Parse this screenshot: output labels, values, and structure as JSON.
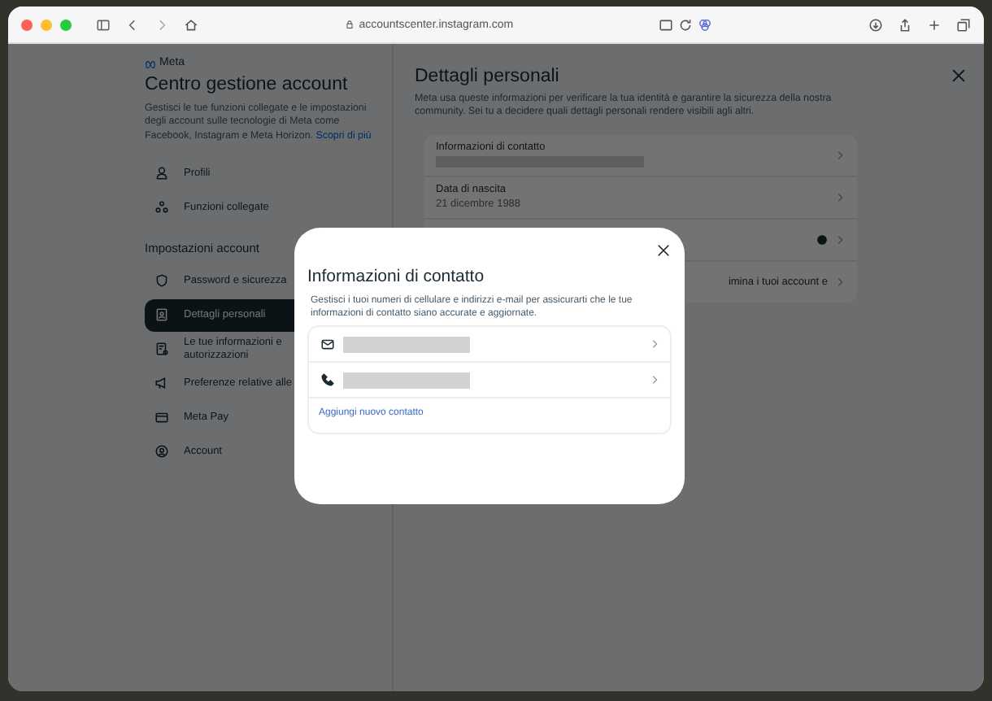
{
  "browser": {
    "url": "accountscenter.instagram.com"
  },
  "sidebar": {
    "brand": "Meta",
    "title": "Centro gestione account",
    "description": "Gestisci le tue funzioni collegate e le impostazioni degli account sulle tecnologie di Meta come Facebook, Instagram e Meta Horizon.",
    "link": "Scopri di più",
    "items": [
      {
        "label": "Profili",
        "selected": false
      },
      {
        "label": "Funzioni collegate",
        "selected": false
      }
    ],
    "section": "Impostazioni account",
    "settings_items": [
      {
        "label": "Password e sicurezza",
        "selected": false
      },
      {
        "label": "Dettagli personali",
        "selected": true
      },
      {
        "label": "Le tue informazioni e autorizzazioni",
        "selected": false
      },
      {
        "label": "Preferenze relative alle",
        "selected": false
      },
      {
        "label": "Meta Pay",
        "selected": false
      },
      {
        "label": "Account",
        "selected": false
      }
    ]
  },
  "main": {
    "title": "Dettagli personali",
    "description": "Meta usa queste informazioni per verificare la tua identità e garantire la sicurezza della nostra community. Sei tu a decidere quali dettagli personali rendere visibili agli altri.",
    "rows": [
      {
        "kind": "redacted",
        "label": "Informazioni di contatto"
      },
      {
        "kind": "value",
        "label": "Data di nascita",
        "value": "21 dicembre 1988"
      },
      {
        "kind": "icon"
      },
      {
        "kind": "text",
        "text": "imina i tuoi account e"
      }
    ]
  },
  "dialog": {
    "title": "Informazioni di contatto",
    "description": "Gestisci i tuoi numeri di cellulare e indirizzi e-mail per assicurarti che le tue informazioni di contatto siano accurate e aggiornate.",
    "contacts": [
      {
        "kind": "email"
      },
      {
        "kind": "phone"
      }
    ],
    "link": "Aggiungi nuovo contatto"
  }
}
